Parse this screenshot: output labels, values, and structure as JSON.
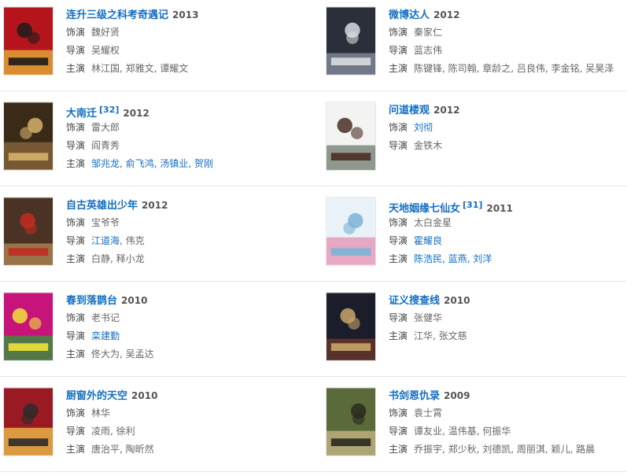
{
  "labels": {
    "role": "饰演",
    "director": "导演",
    "cast": "主演"
  },
  "rows": [
    {
      "left": {
        "title": "连升三级之科考奇遇记",
        "ref": "",
        "year": "2013",
        "poster_icon": "poster-lianshengsanji",
        "poster_colors": [
          "#b5151a",
          "#e8b43a",
          "#1c1c1c"
        ],
        "role": "魏好贤",
        "director": "吴耀权",
        "cast": "林江国, 郑雅文, 谭耀文",
        "links": {
          "role": false,
          "director": false,
          "cast": false
        }
      },
      "right": {
        "title": "微博达人",
        "ref": "",
        "year": "2012",
        "poster_icon": "poster-weibodaren",
        "poster_colors": [
          "#2b2f3a",
          "#8a93a3",
          "#d9dbe0"
        ],
        "role": "秦家仁",
        "director": "蓝志伟",
        "cast": "陈键锋, 陈司翰, 章龄之, 吕良伟, 李金铭, 吴昊泽",
        "links": {
          "role": false,
          "director": false,
          "cast": false
        }
      }
    },
    {
      "left": {
        "title": "大南迁",
        "ref": "[32]",
        "year": "2012",
        "poster_icon": "poster-danangian",
        "poster_colors": [
          "#3a2a18",
          "#8b6a3b",
          "#d6b06a"
        ],
        "role": "雷大郎",
        "director": "阎青秀",
        "cast": "邹兆龙, 俞飞鸿, 汤镇业, 贺刚",
        "links": {
          "role": false,
          "director": false,
          "cast": true
        }
      },
      "right": {
        "title": "问道楼观",
        "ref": "",
        "year": "2012",
        "poster_icon": "poster-wendaolouguan",
        "poster_colors": [
          "#f3f3f1",
          "#6d7a6a",
          "#4a2d24"
        ],
        "role": "刘彻",
        "director": "金铁木",
        "cast": "",
        "links": {
          "role": true,
          "director": false,
          "cast": false
        }
      }
    },
    {
      "left": {
        "title": "自古英雄出少年",
        "ref": "",
        "year": "2012",
        "poster_icon": "poster-zigu",
        "poster_colors": [
          "#4a3324",
          "#b68a55",
          "#c22b21"
        ],
        "role": "宝爷爷",
        "director": "江道海, 伟克",
        "cast": "白静, 释小龙",
        "links": {
          "role": false,
          "director": "partial",
          "cast": false
        }
      },
      "right": {
        "title": "天地姻缘七仙女",
        "ref": "[31]",
        "year": "2011",
        "poster_icon": "poster-qixiannv",
        "poster_colors": [
          "#e9f2f6",
          "#e48fb0",
          "#7bb3d6"
        ],
        "role": "太白金星",
        "director": "霍耀良",
        "cast": "陈浩民, 蓝燕, 刘洋",
        "links": {
          "role": false,
          "director": true,
          "cast": true
        }
      }
    },
    {
      "left": {
        "title": "春到落鹊台",
        "ref": "",
        "year": "2010",
        "poster_icon": "poster-chundao",
        "poster_colors": [
          "#c6147a",
          "#2f9a3a",
          "#f3e23a"
        ],
        "role": "老书记",
        "director": "栾建勤",
        "cast": "佟大为, 吴孟达",
        "links": {
          "role": false,
          "director": true,
          "cast": false
        }
      },
      "right": {
        "title": "证义搜查线",
        "ref": "",
        "year": "2010",
        "poster_icon": "poster-zhengyi",
        "poster_colors": [
          "#1b1d2b",
          "#6e3a2b",
          "#c9a46a"
        ],
        "role": "",
        "director": "张健华",
        "cast": "江华, 张文慈",
        "links": {
          "role": false,
          "director": false,
          "cast": false
        }
      }
    },
    {
      "left": {
        "title": "厨窗外的天空",
        "ref": "",
        "year": "2010",
        "poster_icon": "poster-chuchuang",
        "poster_colors": [
          "#9a1a24",
          "#f2c64a",
          "#2b2b2b"
        ],
        "role": "林华",
        "director": "凌雨, 徐利",
        "cast": "唐治平, 陶昕然",
        "links": {
          "role": false,
          "director": false,
          "cast": false
        }
      },
      "right": {
        "title": "书剑恩仇录",
        "ref": "",
        "year": "2009",
        "poster_icon": "poster-shujian",
        "poster_colors": [
          "#5b6a3a",
          "#c9b98a",
          "#2a2a1e"
        ],
        "role": "袁士霄",
        "director": "谭友业, 温伟基, 何振华",
        "cast": "乔振宇, 郑少秋, 刘德凯, 周丽淇, 颖儿, 路晨",
        "links": {
          "role": false,
          "director": false,
          "cast": false
        }
      }
    }
  ]
}
